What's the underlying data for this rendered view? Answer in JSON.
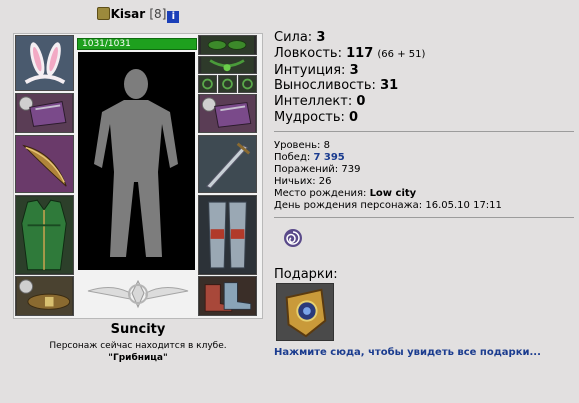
{
  "character": {
    "name": "Kisar",
    "level": "[8]",
    "info_icon": "i",
    "hp": "1031/1031"
  },
  "location": {
    "city": "Suncity",
    "club_text": "Персонаж сейчас находится в клубе.",
    "club_name": "\"Грибница\""
  },
  "stats": [
    {
      "label": "Сила:",
      "value": "3",
      "bonus": ""
    },
    {
      "label": "Ловкость:",
      "value": "117",
      "bonus": "(66 + 51)"
    },
    {
      "label": "Интуиция:",
      "value": "3",
      "bonus": ""
    },
    {
      "label": "Выносливость:",
      "value": "31",
      "bonus": ""
    },
    {
      "label": "Интеллект:",
      "value": "0",
      "bonus": ""
    },
    {
      "label": "Мудрость:",
      "value": "0",
      "bonus": ""
    }
  ],
  "info": {
    "level_label": "Уровень:",
    "level_value": "8",
    "wins_label": "Побед:",
    "wins_value": "7 395",
    "losses_label": "Поражений:",
    "losses_value": "739",
    "draws_label": "Ничьих:",
    "draws_value": "26",
    "birthplace_label": "Место рождения:",
    "birthplace_value": "Low city",
    "birthday_label": "День рождения персонажа:",
    "birthday_value": "16.05.10 17:11"
  },
  "gifts": {
    "label": "Подарки:",
    "link": "Нажмите сюда, чтобы увидеть все подарки..."
  },
  "icons": {
    "clan": "clan-icon",
    "info": "info-icon",
    "badge": "spiral-badge-icon",
    "gift": "shield-gift-icon"
  },
  "colors": {
    "hp_bar": "#1ea01e",
    "link": "#1b3c8f",
    "background": "#e2e0e0"
  }
}
